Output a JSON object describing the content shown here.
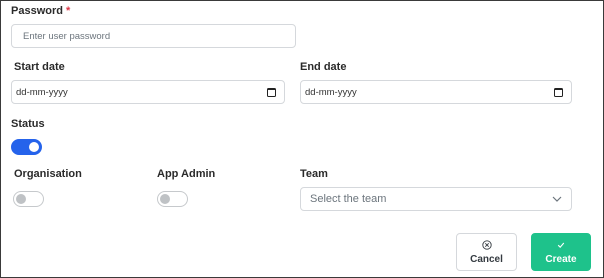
{
  "password": {
    "label": "Password",
    "required_mark": "*",
    "placeholder": "Enter user password"
  },
  "start_date": {
    "label": "Start date",
    "value": "dd-mm-yyyy"
  },
  "end_date": {
    "label": "End date",
    "value": "dd-mm-yyyy"
  },
  "status": {
    "label": "Status",
    "enabled": true
  },
  "organisation": {
    "label": "Organisation",
    "enabled": false
  },
  "app_admin": {
    "label": "App Admin",
    "enabled": false
  },
  "team": {
    "label": "Team",
    "placeholder": "Select the team"
  },
  "actions": {
    "cancel_label": "Cancel",
    "create_label": "Create"
  },
  "colors": {
    "accent": "#2563eb",
    "create_button": "#1ec28b",
    "required": "#dc3545"
  }
}
